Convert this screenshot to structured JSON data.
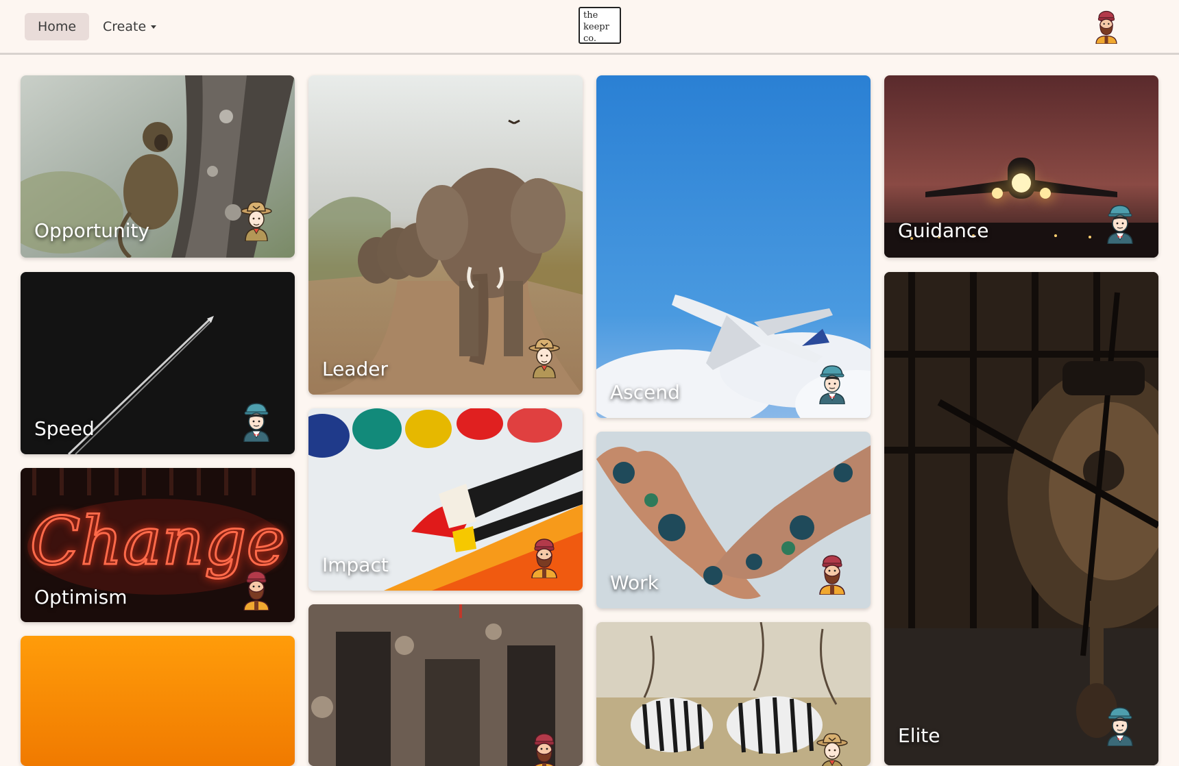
{
  "nav": {
    "home_label": "Home",
    "create_label": "Create",
    "logo_text": "the\nkeepr\nco."
  },
  "cards": [
    {
      "title": "Opportunity",
      "avatar": "ranger-hat-avatar-icon"
    },
    {
      "title": "Speed",
      "avatar": "cap-avatar-icon"
    },
    {
      "title": "Optimism",
      "avatar": "bearded-avatar-icon"
    },
    {
      "title": "",
      "avatar": ""
    },
    {
      "title": "Leader",
      "avatar": "ranger-hat-avatar-icon"
    },
    {
      "title": "Impact",
      "avatar": "bearded-avatar-icon"
    },
    {
      "title": "",
      "avatar": "bearded-avatar-icon"
    },
    {
      "title": "Ascend",
      "avatar": "cap-avatar-icon"
    },
    {
      "title": "Work",
      "avatar": "bearded-avatar-icon"
    },
    {
      "title": "",
      "avatar": "ranger-hat-avatar-icon"
    },
    {
      "title": "Guidance",
      "avatar": "cap-avatar-icon"
    },
    {
      "title": "Elite",
      "avatar": "cap-avatar-icon"
    }
  ],
  "neon_sign_text": "Change",
  "colors": {
    "background": "#fdf6f1",
    "nav_active": "#e9dcd9",
    "title_text": "#ffffff"
  }
}
